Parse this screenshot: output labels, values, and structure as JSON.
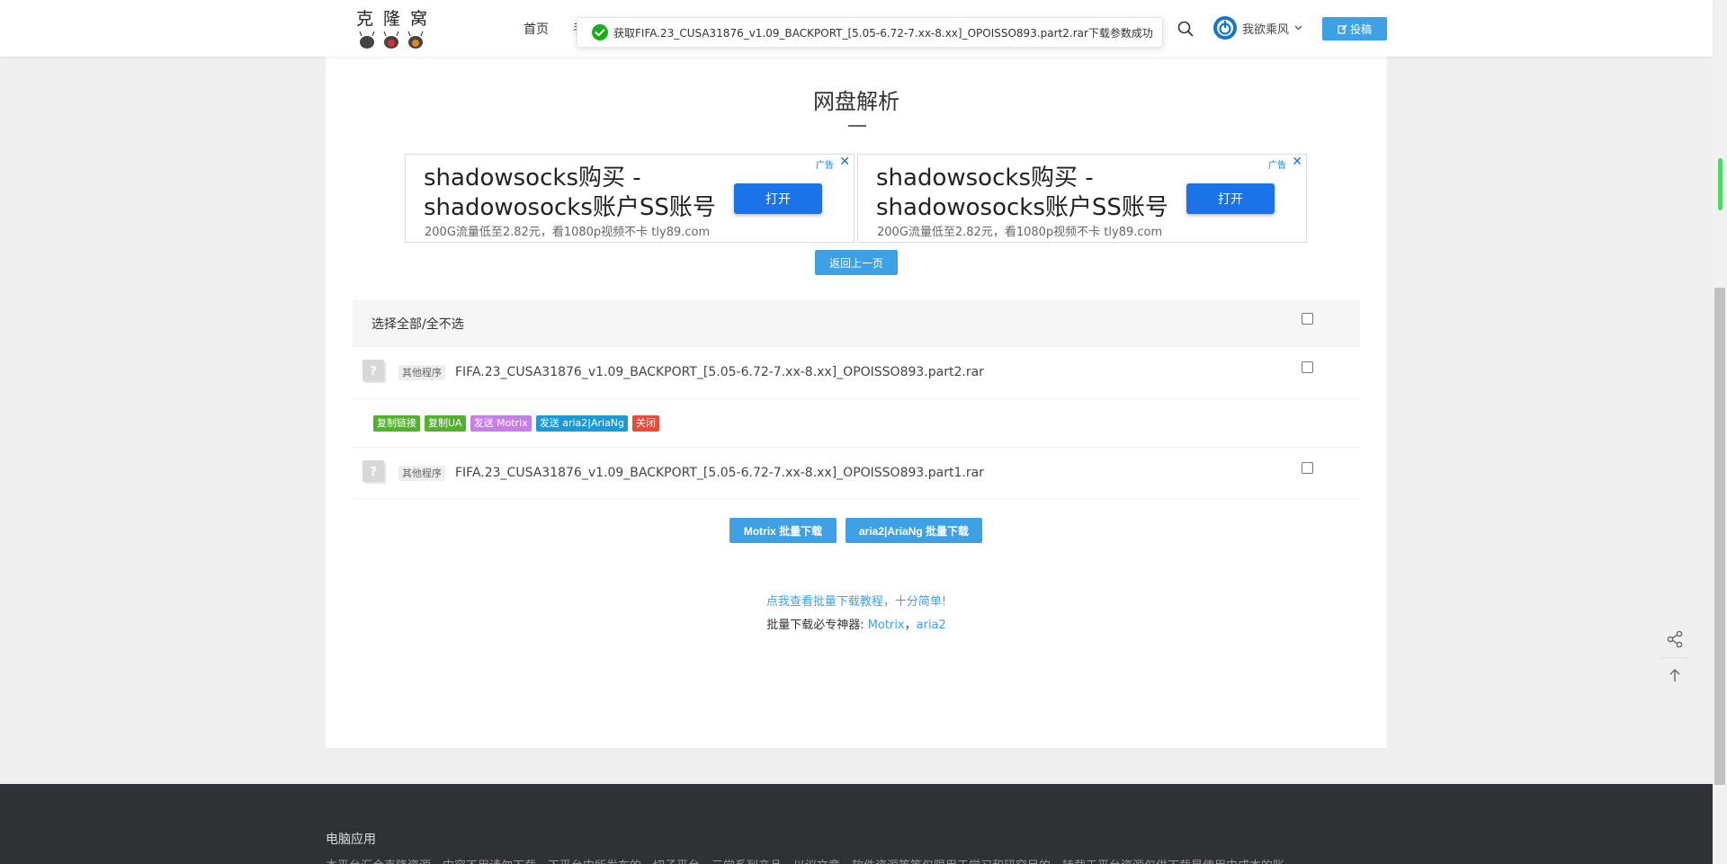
{
  "header": {
    "logo_text": "克隆窝",
    "nav_home": "首页",
    "nav_partial": "手",
    "toast_text": "获取FIFA.23_CUSA31876_v1.09_BACKPORT_[5.05-6.72-7.xx-8.xx]_OPOISSO893.part2.rar下载参数成功",
    "username": "我欲乘风",
    "contribute_label": "投稿",
    "colors": {
      "accent": "#3ea1e5",
      "toast_success": "#1aad19"
    }
  },
  "main": {
    "title": "网盘解析",
    "ads": [
      {
        "label": "广告",
        "title_line1": "shadowsocks购买 -",
        "title_line2": "shadowosocks账户SS账号",
        "subtitle": "200G流量低至2.82元，看1080p视频不卡 tly89.com",
        "button": "打开"
      },
      {
        "label": "广告",
        "title_line1": "shadowsocks购买 -",
        "title_line2": "shadowosocks账户SS账号",
        "subtitle": "200G流量低至2.82元，看1080p视频不卡 tly89.com",
        "button": "打开"
      }
    ],
    "back_button": "返回上一页",
    "select_all_label": "选择全部/全不选",
    "files": [
      {
        "type_badge": "其他程序",
        "name": "FIFA.23_CUSA31876_v1.09_BACKPORT_[5.05-6.72-7.xx-8.xx]_OPOISSO893.part2.rar",
        "icon": "unknown-file-icon"
      },
      {
        "type_badge": "其他程序",
        "name": "FIFA.23_CUSA31876_v1.09_BACKPORT_[5.05-6.72-7.xx-8.xx]_OPOISSO893.part1.rar",
        "icon": "unknown-file-icon"
      }
    ],
    "actions": [
      {
        "label": "复制链接",
        "color": "#52b22d"
      },
      {
        "label": "复制UA",
        "color": "#52b22d"
      },
      {
        "label": "发送 Motrix",
        "color": "#c77ee6"
      },
      {
        "label": "发送 aria2|AriaNg",
        "color": "#1c9ad6"
      },
      {
        "label": "关闭",
        "color": "#e94a3c"
      }
    ],
    "batch_motrix": "Motrix 批量下载",
    "batch_aria": "aria2|AriaNg 批量下载",
    "tutorial_link": "点我查看批量下载教程，十分简单!",
    "tools_prefix": "批量下载必专神器: ",
    "tools_motrix": "Motrix",
    "tools_sep": "，",
    "tools_aria": "aria2"
  },
  "float_tools": {
    "share_icon": "share-icon",
    "top_icon": "arrow-up-icon"
  },
  "footer": {
    "title": "电脑应用",
    "text": "本平台汇合克隆资源，内容不用请勿下载，下平台内所发布的一切子平台，三学系列产品，以议文章，软件资源等等仅限用于学习和研究目的，转载于平台资源仅供下载是使用中成本的账"
  }
}
